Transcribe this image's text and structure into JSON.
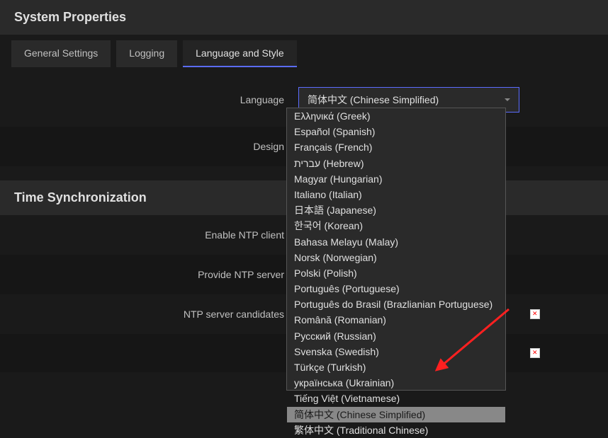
{
  "header1": {
    "title": "System Properties"
  },
  "tabs": {
    "general": "General Settings",
    "logging": "Logging",
    "language": "Language and Style"
  },
  "form": {
    "language_label": "Language",
    "design_label": "Design",
    "selected_language": "简体中文 (Chinese Simplified)"
  },
  "header2": {
    "title": "Time Synchronization"
  },
  "ntp": {
    "enable_label": "Enable NTP client",
    "provide_label": "Provide NTP server",
    "candidates_label": "NTP server candidates"
  },
  "languages": [
    "Ελληνικά (Greek)",
    "Español (Spanish)",
    "Français (French)",
    "עברית (Hebrew)",
    "Magyar (Hungarian)",
    "Italiano (Italian)",
    "日本語 (Japanese)",
    "한국어 (Korean)",
    "Bahasa Melayu (Malay)",
    "Norsk (Norwegian)",
    "Polski (Polish)",
    "Português (Portuguese)",
    "Português do Brasil (Brazlianian Portuguese)",
    "Română (Romanian)",
    "Русский (Russian)",
    "Svenska (Swedish)",
    "Türkçe (Turkish)",
    "українська (Ukrainian)",
    "Tiếng Việt (Vietnamese)",
    "简体中文 (Chinese Simplified)",
    "繁体中文 (Traditional Chinese)"
  ],
  "selected_language_index": 19
}
